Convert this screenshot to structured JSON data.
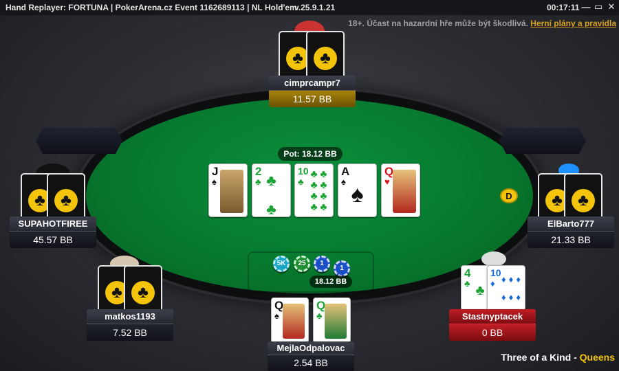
{
  "titlebar": {
    "title": "Hand Replayer: FORTUNA  |  PokerArena.cz Event 1162689113  |  NL Hold'em",
    "version": "v.25.9.1.21",
    "clock": "00:17:11",
    "minimize": "—",
    "maximize": "▭",
    "close": "✕"
  },
  "notice": {
    "text": "18+. Účast na hazardní hře může být škodlivá.",
    "link": "Herní plány a pravidla"
  },
  "pot": {
    "label": "Pot: 18.12 BB",
    "chip_amount": "18.12 BB",
    "chips": [
      "5K",
      "25",
      "1",
      "1"
    ]
  },
  "board": [
    {
      "rank": "J",
      "suit": "♠",
      "color": "black"
    },
    {
      "rank": "2",
      "suit": "♣",
      "color": "green"
    },
    {
      "rank": "10",
      "suit": "♣",
      "color": "green"
    },
    {
      "rank": "A",
      "suit": "♠",
      "color": "black"
    },
    {
      "rank": "Q",
      "suit": "♥",
      "color": "red"
    }
  ],
  "players": {
    "top": {
      "name": "cimprcampr7",
      "stack": "11.57 BB"
    },
    "left": {
      "name": "SUPAHOTFIREE",
      "stack": "45.57 BB"
    },
    "right": {
      "name": "ElBarto777",
      "stack": "21.33 BB"
    },
    "bottom_left": {
      "name": "matkos1193",
      "stack": "7.52 BB"
    },
    "bottom": {
      "name": "MejlaOdpalovac",
      "stack": "2.54 BB",
      "cards": [
        {
          "rank": "Q",
          "suit": "♠"
        },
        {
          "rank": "Q",
          "suit": "♣"
        }
      ]
    },
    "bottom_right": {
      "name": "Stastnyptacek",
      "stack": "0 BB",
      "cards": [
        {
          "rank": "4",
          "suit": "♣"
        },
        {
          "rank": "10",
          "suit": "♦"
        }
      ]
    }
  },
  "dealer_button": "D",
  "card_back_symbol": "♣",
  "result": {
    "prefix": "Three of a Kind - ",
    "highlight": "Queens"
  },
  "colors": {
    "felt": "#07792f",
    "accent": "#f2c20b",
    "folded_plate": "#c11e24"
  }
}
